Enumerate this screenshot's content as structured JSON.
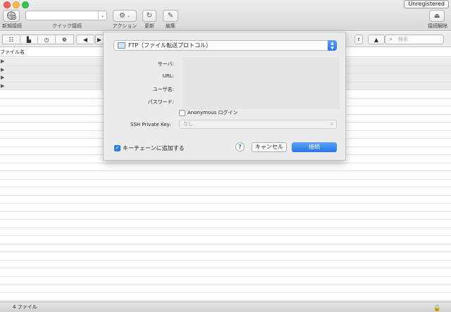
{
  "window": {
    "unregistered_label": "Unregistered"
  },
  "toolbar": {
    "new_connection_label": "新規接続",
    "quick_connect_label": "クイック接続",
    "quick_connect_value": "",
    "action_label": "アクション",
    "refresh_label": "更新",
    "edit_label": "編集",
    "disconnect_label": "接続解除"
  },
  "search": {
    "placeholder": "検索"
  },
  "file_list": {
    "column_name": "ファイル名",
    "expandable_rows": 4
  },
  "status": {
    "file_count": "4 ファイル"
  },
  "dialog": {
    "protocol": "FTP（ファイル転送プロトコル）",
    "server_label": "サーバ:",
    "url_label": "URL:",
    "username_label": "ユーザ名:",
    "password_label": "パスワード:",
    "anonymous_label": "Anonymous ログイン",
    "ssh_key_label": "SSH Private Key:",
    "ssh_key_value": "なし",
    "keychain_label": "キーチェーンに追加する",
    "help_label": "?",
    "cancel_label": "キャンセル",
    "connect_label": "接続"
  },
  "colors": {
    "accent": "#2a7bed",
    "toolbar_bg": "#e3e3e3",
    "sheet_bg": "#ececec"
  }
}
